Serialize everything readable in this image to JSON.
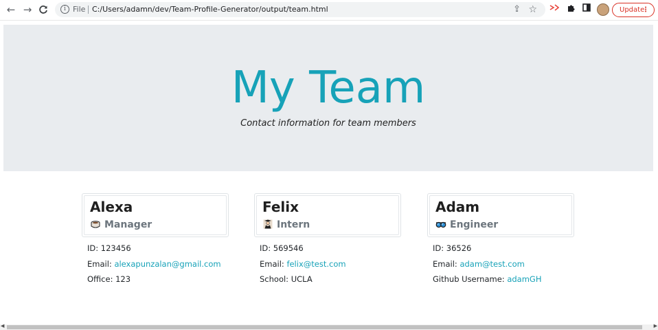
{
  "browser": {
    "back_icon": "←",
    "forward_icon": "→",
    "reload_icon": "C",
    "file_label": "File",
    "url": "C:/Users/adamn/dev/Team-Profile-Generator/output/team.html",
    "update_label": "Update",
    "update_dots": "⋮"
  },
  "header": {
    "title": "My Team",
    "subtitle": "Contact information for team members"
  },
  "team": [
    {
      "name": "Alexa",
      "role": "Manager",
      "role_icon": "coffee-mug-icon",
      "id_label": "ID: ",
      "id": "123456",
      "email_label": "Email: ",
      "email": "alexapunzalan@gmail.com",
      "extra_label": "Office: ",
      "extra_value": "123"
    },
    {
      "name": "Felix",
      "role": "Intern",
      "role_icon": "student-icon",
      "id_label": "ID: ",
      "id": "569546",
      "email_label": "Email: ",
      "email": "felix@test.com",
      "extra_label": "School: ",
      "extra_value": "UCLA"
    },
    {
      "name": "Adam",
      "role": "Engineer",
      "role_icon": "goggles-icon",
      "id_label": "ID: ",
      "id": "36526",
      "email_label": "Email: ",
      "email": "adam@test.com",
      "extra_label": "Github Username: ",
      "extra_value": "adamGH"
    }
  ],
  "colors": {
    "accent": "#17a2b8",
    "jumbotron_bg": "#e9ecef",
    "role_text": "#6c757d"
  }
}
